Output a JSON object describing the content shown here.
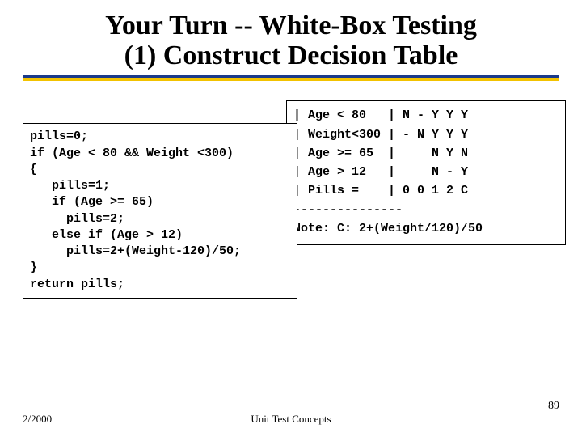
{
  "title_line1": "Your Turn -- White-Box Testing",
  "title_line2": "(1) Construct Decision Table",
  "code": "pills=0;\nif (Age < 80 && Weight <300)\n{\n   pills=1;\n   if (Age >= 65)\n     pills=2;\n   else if (Age > 12)\n     pills=2+(Weight-120)/50;\n}\nreturn pills;",
  "table": "| Age < 80   | N - Y Y Y\n| Weight<300 | - N Y Y Y\n| Age >= 65  |     N Y N\n| Age > 12   |     N - Y\n| Pills =    | 0 0 1 2 C\n---------------\nNote: C: 2+(Weight/120)/50",
  "chart_data": {
    "type": "table",
    "conditions": [
      {
        "name": "Age < 80",
        "values": [
          "N",
          "-",
          "Y",
          "Y",
          "Y"
        ]
      },
      {
        "name": "Weight<300",
        "values": [
          "-",
          "N",
          "Y",
          "Y",
          "Y"
        ]
      },
      {
        "name": "Age >= 65",
        "values": [
          "",
          "",
          "N",
          "Y",
          "N"
        ]
      },
      {
        "name": "Age > 12",
        "values": [
          "",
          "",
          "N",
          "-",
          "Y"
        ]
      }
    ],
    "action": {
      "name": "Pills =",
      "values": [
        "0",
        "0",
        "1",
        "2",
        "C"
      ]
    },
    "note": "C: 2+(Weight/120)/50"
  },
  "footer": {
    "date": "2/2000",
    "center": "Unit Test Concepts",
    "page": "89"
  }
}
